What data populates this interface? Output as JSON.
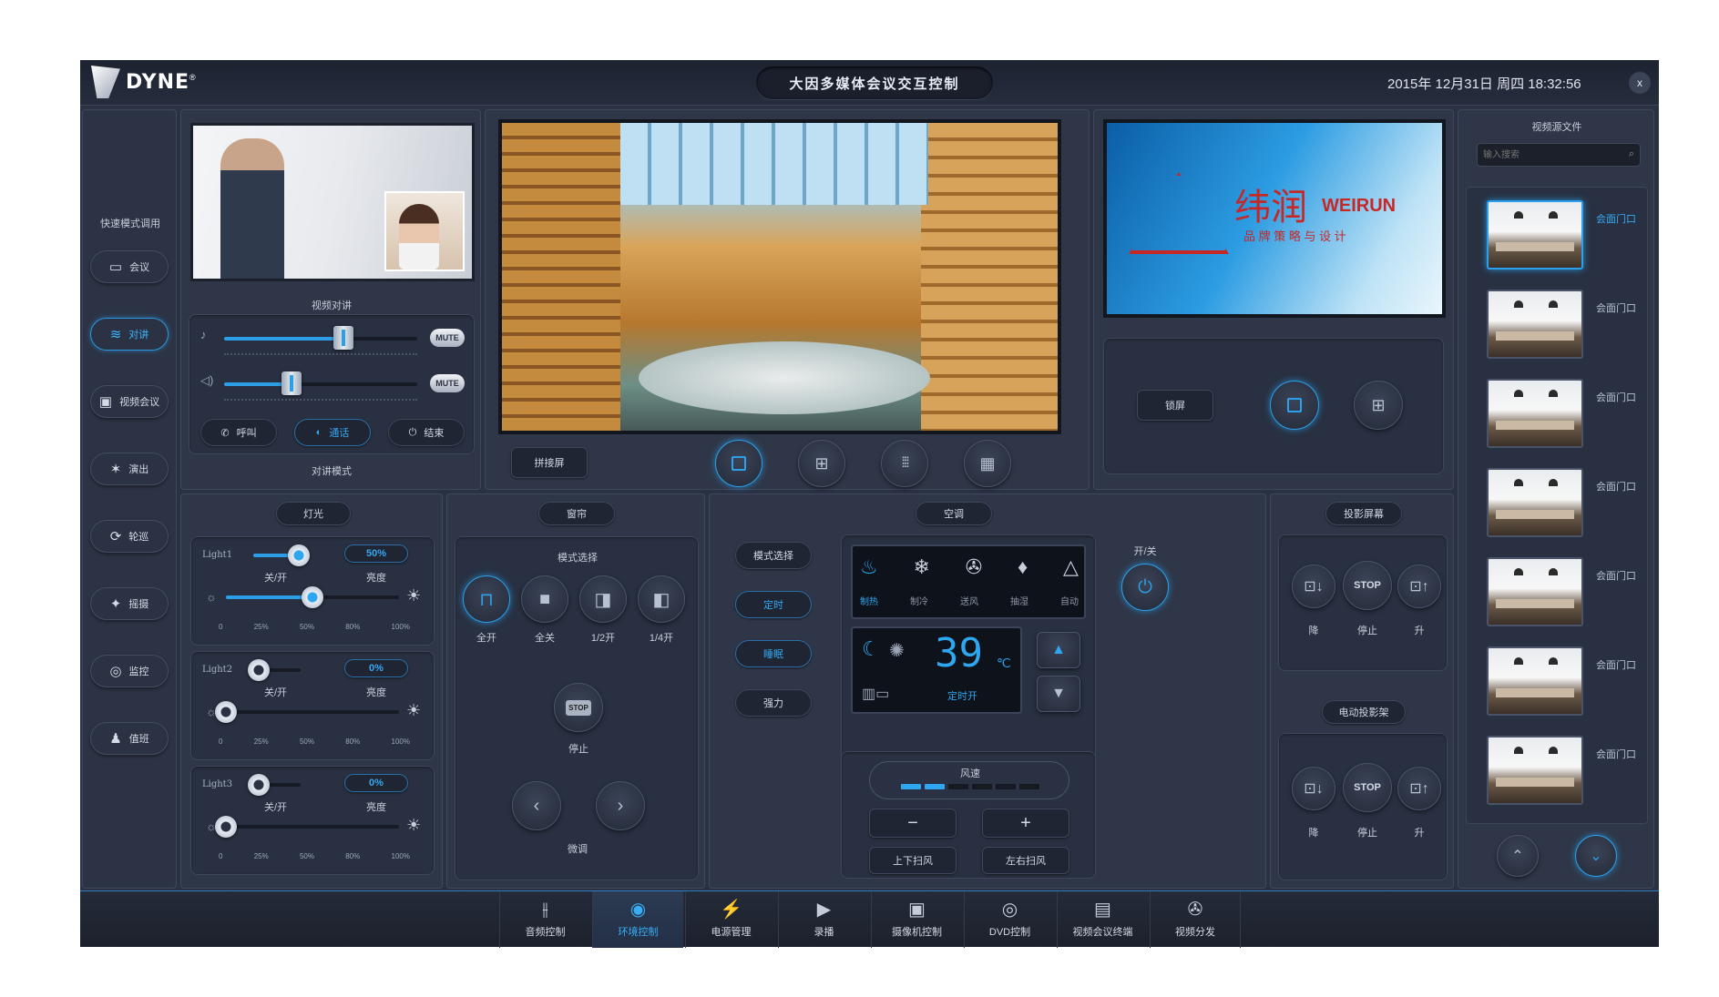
{
  "app": {
    "brand": "DYNE",
    "brand_mark": "®",
    "title": "大因多媒体会议交互控制",
    "datetime": "2015年 12月31日 周四 18:32:56",
    "close_label": "x"
  },
  "sidebar": {
    "heading": "快速模式调用",
    "items": [
      {
        "label": "会议",
        "icon": "chat-icon",
        "active": false
      },
      {
        "label": "对讲",
        "icon": "wifi-icon",
        "active": true
      },
      {
        "label": "视频会议",
        "icon": "video-icon",
        "active": false
      },
      {
        "label": "演出",
        "icon": "dance-icon",
        "active": false
      },
      {
        "label": "轮巡",
        "icon": "loop-icon",
        "active": false
      },
      {
        "label": "摇摄",
        "icon": "camera-icon",
        "active": false
      },
      {
        "label": "监控",
        "icon": "monitor-icon",
        "active": false
      },
      {
        "label": "值班",
        "icon": "person-icon",
        "active": false
      }
    ]
  },
  "intercom": {
    "caption": "视频对讲",
    "mute_label": "MUTE",
    "mic_level": 0.62,
    "speaker_level": 0.35,
    "buttons": {
      "call": "呼叫",
      "talk": "通话",
      "end": "结束"
    },
    "mode_label": "对讲模式"
  },
  "main_display": {
    "pip_label": "拼接屏",
    "layouts": [
      "1",
      "4",
      "9",
      "16"
    ],
    "selected_layout": "1"
  },
  "right_display": {
    "logo_cn": "纬润",
    "logo_en": "WEIRUN",
    "logo_tagline": "品 牌 策 略 与 设 计",
    "button_label": "锁屏",
    "selected_layout": "1"
  },
  "video_source": {
    "title": "视频源文件",
    "search_placeholder": "输入搜索",
    "items": [
      "会面门口",
      "会面门口",
      "会面门口",
      "会面门口",
      "会面门口",
      "会面门口",
      "会面门口"
    ]
  },
  "lighting": {
    "title": "灯光",
    "lights": [
      {
        "name": "Light1",
        "switch_label": "关/开",
        "percent": "50%",
        "brightness_label": "亮度",
        "level": 0.5,
        "on": true
      },
      {
        "name": "Light2",
        "switch_label": "关/开",
        "percent": "0%",
        "brightness_label": "亮度",
        "level": 0,
        "on": false
      },
      {
        "name": "Light3",
        "switch_label": "关/开",
        "percent": "0%",
        "brightness_label": "亮度",
        "level": 0,
        "on": false
      }
    ],
    "ticks": [
      "0",
      "25%",
      "50%",
      "80%",
      "100%"
    ]
  },
  "curtain": {
    "title": "窗帘",
    "mode_label": "模式选择",
    "modes": [
      "全开",
      "全关",
      "1/2开",
      "1/4开"
    ],
    "stop_btn": "STOP",
    "stop_label": "停止",
    "fine_label": "微调"
  },
  "ac": {
    "title": "空调",
    "power_label": "开/关",
    "side_buttons": [
      "模式选择",
      "定时",
      "睡眠",
      "强力"
    ],
    "modes": [
      "制热",
      "制冷",
      "送风",
      "抽湿",
      "自动"
    ],
    "temperature": "39",
    "unit": "℃",
    "timer_label": "定时开",
    "fan_label": "风速",
    "fan_level": 2,
    "fan_levels": 6,
    "minus": "−",
    "plus": "+",
    "swing_v": "上下扫风",
    "swing_h": "左右扫风"
  },
  "projector_screen": {
    "title": "投影屏幕",
    "down": "降",
    "stop_btn": "STOP",
    "stop": "停止",
    "up": "升"
  },
  "projector_lift": {
    "title": "电动投影架",
    "down": "降",
    "stop_btn": "STOP",
    "stop": "停止",
    "up": "升"
  },
  "bottom_nav": [
    {
      "label": "音频控制",
      "icon": "mixer-icon",
      "active": false
    },
    {
      "label": "环境控制",
      "icon": "environment-icon",
      "active": true
    },
    {
      "label": "电源管理",
      "icon": "plug-icon",
      "active": false
    },
    {
      "label": "录播",
      "icon": "play-icon",
      "active": false
    },
    {
      "label": "摄像机控制",
      "icon": "camera-icon",
      "active": false
    },
    {
      "label": "DVD控制",
      "icon": "disc-icon",
      "active": false
    },
    {
      "label": "视频会议终端",
      "icon": "conference-icon",
      "active": false
    },
    {
      "label": "视频分发",
      "icon": "reel-icon",
      "active": false
    }
  ],
  "colors": {
    "accent": "#2d9fe6",
    "background": "#2a3143",
    "panel": "#2f3647"
  }
}
